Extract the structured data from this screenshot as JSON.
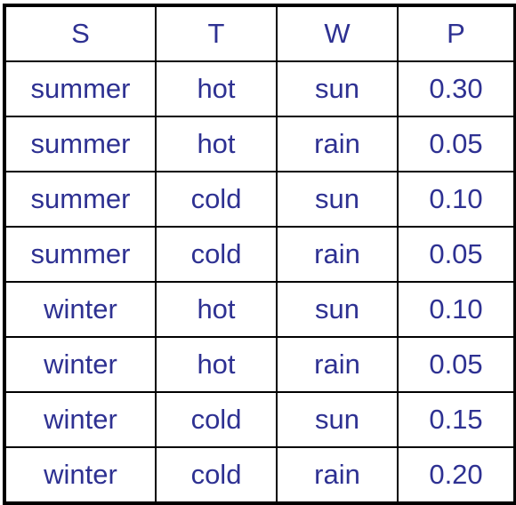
{
  "table": {
    "headers": [
      "S",
      "T",
      "W",
      "P"
    ],
    "rows": [
      [
        "summer",
        "hot",
        "sun",
        "0.30"
      ],
      [
        "summer",
        "hot",
        "rain",
        "0.05"
      ],
      [
        "summer",
        "cold",
        "sun",
        "0.10"
      ],
      [
        "summer",
        "cold",
        "rain",
        "0.05"
      ],
      [
        "winter",
        "hot",
        "sun",
        "0.10"
      ],
      [
        "winter",
        "hot",
        "rain",
        "0.05"
      ],
      [
        "winter",
        "cold",
        "sun",
        "0.15"
      ],
      [
        "winter",
        "cold",
        "rain",
        "0.20"
      ]
    ]
  },
  "colors": {
    "text": "#2e3192",
    "border": "#000000"
  }
}
